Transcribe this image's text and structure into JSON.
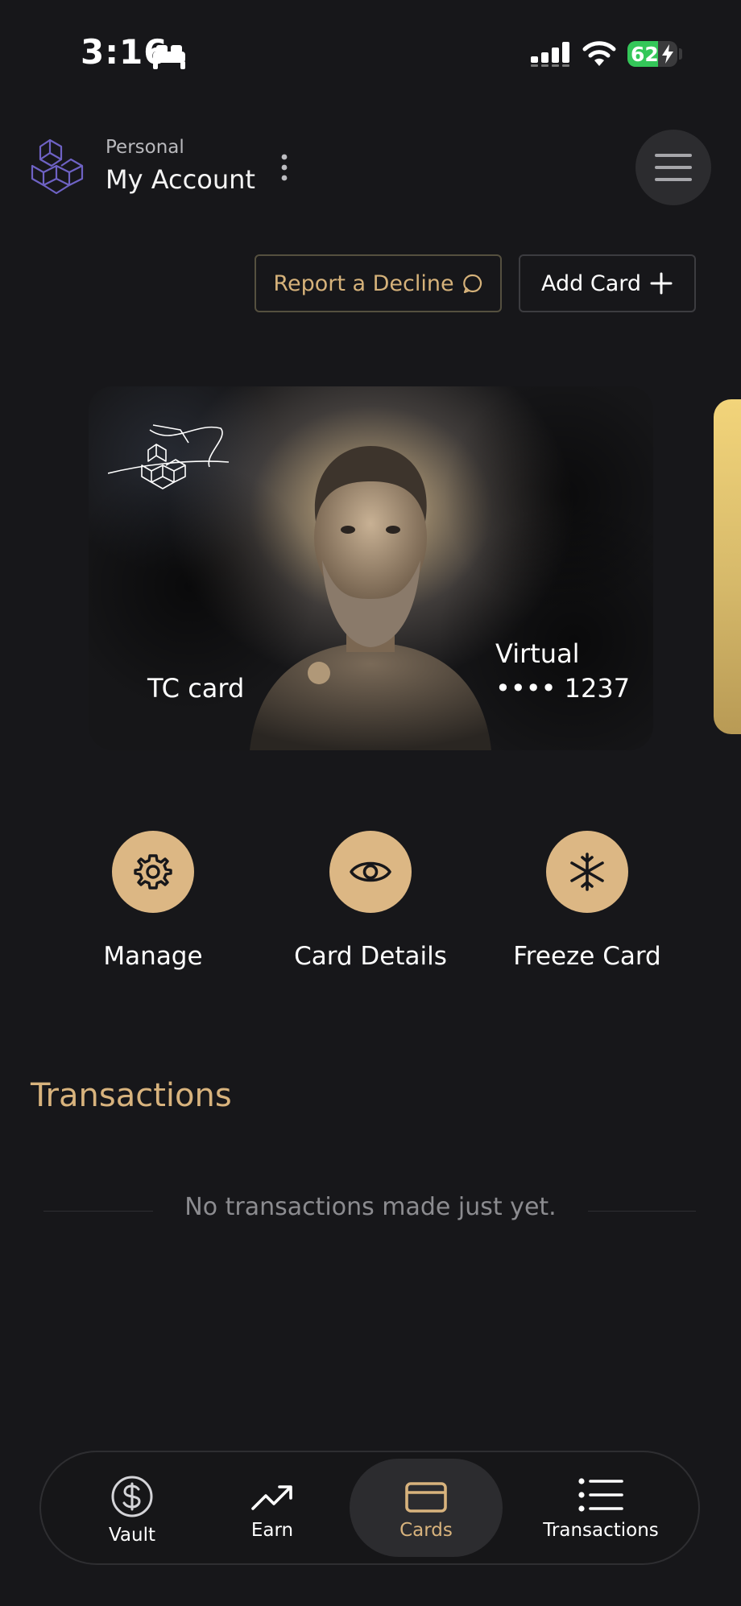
{
  "status_bar": {
    "time": "3:16",
    "battery": "62",
    "battery_level": 0.62
  },
  "header": {
    "account_type": "Personal",
    "account_name": "My Account"
  },
  "actions_top": {
    "report_label": "Report a Decline",
    "add_card_label": "Add Card"
  },
  "card": {
    "name": "TC card",
    "type": "Virtual",
    "number": "•••• 1237"
  },
  "card_actions": [
    {
      "label": "Manage",
      "icon": "gear-icon"
    },
    {
      "label": "Card Details",
      "icon": "eye-icon"
    },
    {
      "label": "Freeze Card",
      "icon": "snowflake-icon"
    }
  ],
  "transactions": {
    "title": "Transactions",
    "empty_text": "No transactions made just yet."
  },
  "nav": [
    {
      "label": "Vault",
      "icon": "dollar-circle-icon",
      "active": false
    },
    {
      "label": "Earn",
      "icon": "trending-up-icon",
      "active": false
    },
    {
      "label": "Cards",
      "icon": "card-icon",
      "active": true
    },
    {
      "label": "Transactions",
      "icon": "list-icon",
      "active": false
    }
  ],
  "colors": {
    "accent": "#dcb784",
    "accent_text": "#d8b37d",
    "background": "#17171a",
    "battery_green": "#34c759"
  }
}
